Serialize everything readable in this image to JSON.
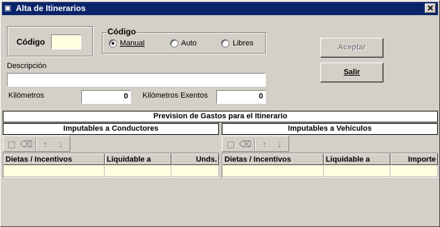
{
  "window": {
    "title": "Alta de Itinerarios",
    "close_glyph": "✕"
  },
  "codigo": {
    "label": "Código",
    "value": ""
  },
  "codigo_mode": {
    "legend": "Código",
    "options": [
      {
        "label": "Manual",
        "selected": true
      },
      {
        "label": "Auto",
        "selected": false
      },
      {
        "label": "Libres",
        "selected": false
      }
    ]
  },
  "buttons": {
    "accept_label": "Aceptar",
    "exit_label": "Salir"
  },
  "descripcion": {
    "label": "Descripción",
    "value": ""
  },
  "kilometros": {
    "label": "Kilómetros",
    "value": "0"
  },
  "kilometros_exentos": {
    "label": "Kilómetros Exentos",
    "value": "0"
  },
  "prevision": {
    "title": "Prevision de Gastos para el Itinerario"
  },
  "conductores": {
    "title": "Imputables a Conductores",
    "columns": [
      "Dietas / Incentivos",
      "Liquidable a",
      "Unds."
    ],
    "toolbar_icons": [
      "new-icon",
      "erase-icon",
      "arrow-up-icon",
      "arrow-down-icon"
    ]
  },
  "vehiculos": {
    "title": "Imputables a Vehículos",
    "columns": [
      "Dietas / Incentivos",
      "Liquidable a",
      "Importe"
    ],
    "toolbar_icons": [
      "new-icon",
      "erase-icon",
      "arrow-up-icon",
      "arrow-down-icon"
    ]
  },
  "colors": {
    "titlebar": "#0a246a",
    "face": "#d4d0c8",
    "highlight_field": "#ffffe1"
  }
}
